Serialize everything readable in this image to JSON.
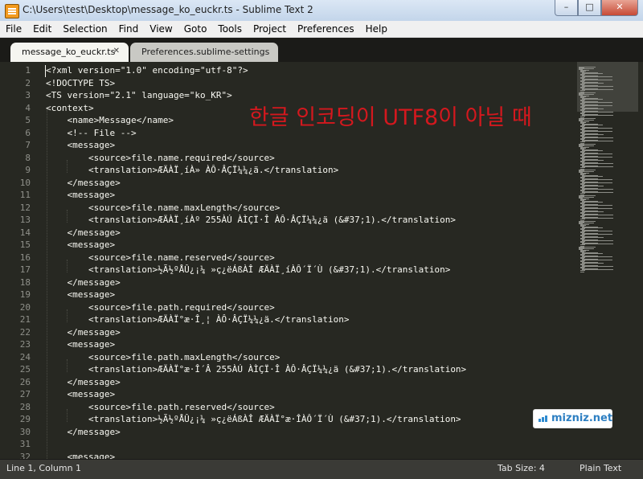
{
  "window": {
    "title": "C:\\Users\\test\\Desktop\\message_ko_euckr.ts - Sublime Text 2",
    "controls": {
      "minimize": "–",
      "maximize": "□",
      "close": "✕"
    }
  },
  "menu": [
    "File",
    "Edit",
    "Selection",
    "Find",
    "View",
    "Goto",
    "Tools",
    "Project",
    "Preferences",
    "Help"
  ],
  "tabs": [
    {
      "label": "message_ko_euckr.ts",
      "close": "✕",
      "active": true
    },
    {
      "label": "Preferences.sublime-settings",
      "close": "",
      "active": false
    }
  ],
  "editor": {
    "line_numbers": [
      "1",
      "2",
      "3",
      "4",
      "5",
      "6",
      "7",
      "8",
      "9",
      "10",
      "11",
      "12",
      "13",
      "14",
      "15",
      "16",
      "17",
      "18",
      "19",
      "20",
      "21",
      "22",
      "23",
      "24",
      "25",
      "26",
      "27",
      "28",
      "29",
      "30",
      "31",
      "32"
    ],
    "lines": [
      "<?xml version=\"1.0\" encoding=\"utf-8\"?>",
      "<!DOCTYPE TS>",
      "<TS version=\"2.1\" language=\"ko_KR\">",
      "<context>",
      "    <name>Message</name>",
      "    <!-- File -->",
      "    <message>",
      "        <source>file.name.required</source>",
      "        <translation>ÆÄÀÏ¸íÀ» ÀÔ·ÂÇÏ¼¼¿ä.</translation>",
      "    </message>",
      "    <message>",
      "        <source>file.name.maxLength</source>",
      "        <translation>ÆÄÀÏ¸íÀº 255ÀÚ ÀÌÇÏ·Î ÀÔ·ÂÇÏ¼¼¿ä (&#37;1).</translation>",
      "    </message>",
      "    <message>",
      "        <source>file.name.reserved</source>",
      "        <translation>½Ã½ºÅÛ¿¡¼­ »ç¿ëÁßÀÎ ÆÄÀÏ¸íÀÔ´Ï´Ù (&#37;1).</translation>",
      "    </message>",
      "    <message>",
      "        <source>file.path.required</source>",
      "        <translation>ÆÄÀÏ°æ·Î¸¦ ÀÔ·ÂÇÏ¼¼¿ä.</translation>",
      "    </message>",
      "    <message>",
      "        <source>file.path.maxLength</source>",
      "        <translation>ÆÄÀÏ°æ·Î´Â 255ÀÚ ÀÌÇÏ·Î ÀÔ·ÂÇÏ¼¼¿ä (&#37;1).</translation>",
      "    </message>",
      "    <message>",
      "        <source>file.path.reserved</source>",
      "        <translation>½Ã½ºÅÛ¿¡¼­ »ç¿ëÁßÀÎ ÆÄÀÏ°æ·ÎÀÔ´Ï´Ù (&#37;1).</translation>",
      "    </message>",
      "",
      "    <message>"
    ],
    "annotation": "한글 인코딩이 UTF8이 아닐 때",
    "colors": {
      "background": "#272822",
      "text": "#f8f8f2",
      "gutter": "#8f908a",
      "annotation": "#d4181e"
    }
  },
  "watermark": {
    "text": "mizniz.net",
    "icon": "bars-logo-icon"
  },
  "status": {
    "position": "Line 1, Column 1",
    "tab_size": "Tab Size: 4",
    "syntax": "Plain Text"
  }
}
